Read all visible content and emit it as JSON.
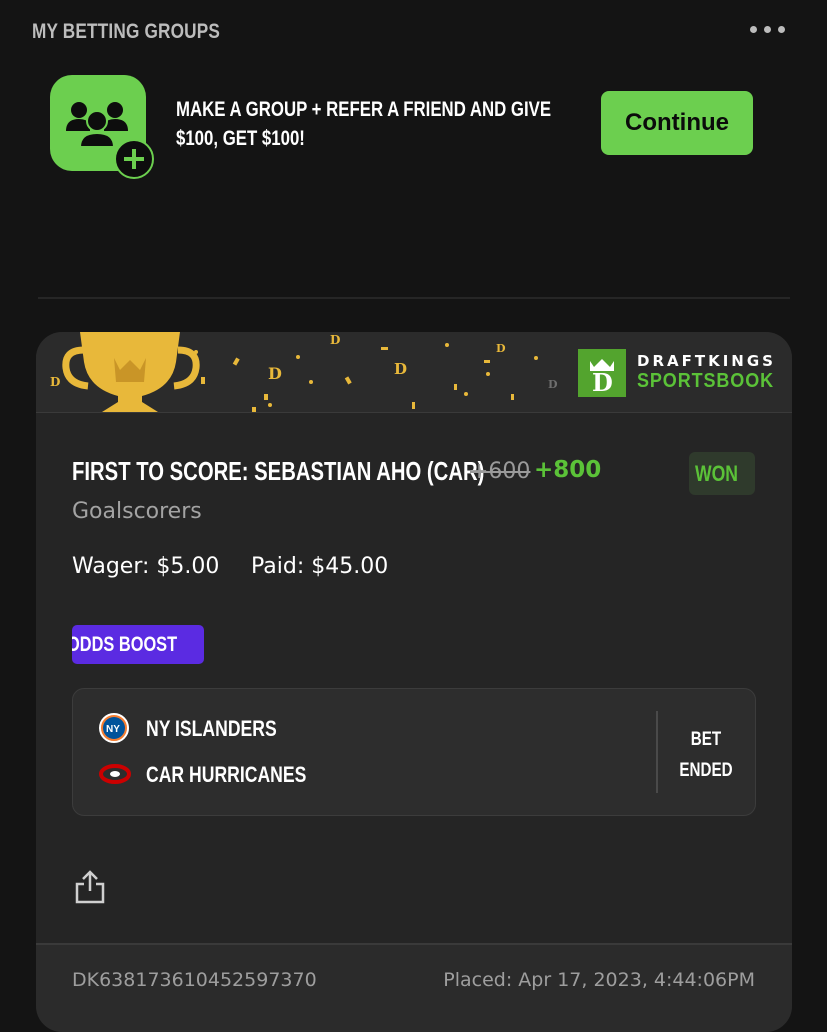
{
  "header": {
    "title": "MY BETTING GROUPS",
    "menu_icon": "more-horizontal-icon"
  },
  "promo": {
    "icon": "group-add-icon",
    "line1": "MAKE A GROUP + REFER A FRIEND AND GIVE",
    "line2": "$100, GET $100!",
    "button_label": "Continue",
    "accent": "#6ccf4f"
  },
  "bet_card": {
    "brand_name": "DRAFTKINGS",
    "brand_sub": "SPORTSBOOK",
    "bet_title": "FIRST TO SCORE: SEBASTIAN AHO (CAR)",
    "odds_original": "+600",
    "odds_boosted": "+800",
    "status": "WON",
    "market": "Goalscorers",
    "wager": "Wager: $5.00",
    "paid": "Paid: $45.00",
    "boost_label": "ODDS BOOST",
    "boost_color": "#5b2be2",
    "event": {
      "teams": [
        {
          "name": "NY ISLANDERS",
          "icon": "ny-islanders-logo-icon"
        },
        {
          "name": "CAR HURRICANES",
          "icon": "car-hurricanes-logo-icon"
        }
      ],
      "status_line1": "BET",
      "status_line2": "ENDED"
    },
    "share_icon": "share-icon",
    "bet_id": "DK638173610452597370",
    "placed": "Placed: Apr 17, 2023, 4:44:06PM"
  }
}
